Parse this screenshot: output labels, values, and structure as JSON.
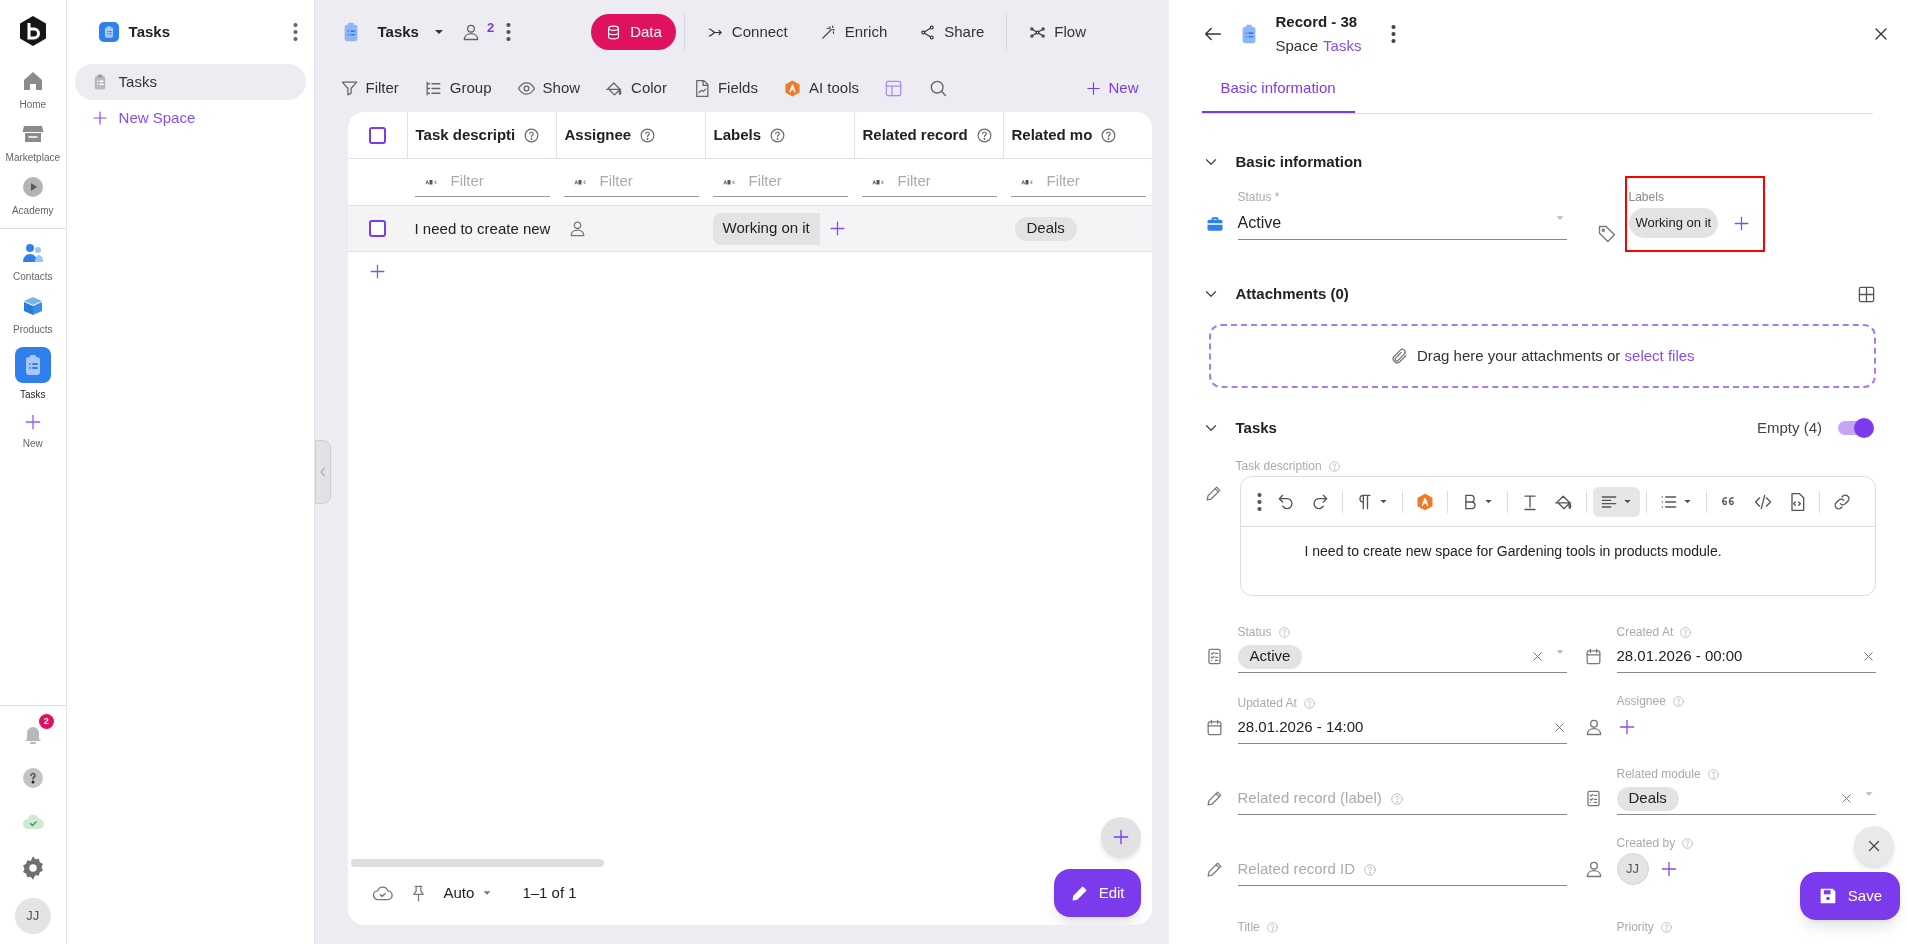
{
  "rail": {
    "items": [
      {
        "label": "Home",
        "kind": "home",
        "selected": false
      },
      {
        "label": "Marketplace",
        "kind": "store",
        "selected": false
      },
      {
        "label": "Academy",
        "kind": "play",
        "selected": false
      },
      {
        "label": "Contacts",
        "kind": "contacts",
        "selected": false
      },
      {
        "label": "Products",
        "kind": "box",
        "selected": false
      },
      {
        "label": "Tasks",
        "kind": "tasks",
        "selected": true
      },
      {
        "label": "New",
        "kind": "new",
        "selected": false
      }
    ],
    "notifications_badge": "2",
    "avatar": "JJ"
  },
  "spaces": {
    "title": "Tasks",
    "items": [
      {
        "label": "Tasks",
        "selected": true
      }
    ],
    "new_space": "New Space"
  },
  "main": {
    "title": "Tasks",
    "members_count": "2",
    "tabs": [
      {
        "label": "Data",
        "kind": "data",
        "selected": true
      },
      {
        "label": "Connect",
        "kind": "connect",
        "selected": false
      },
      {
        "label": "Enrich",
        "kind": "enrich",
        "selected": false
      },
      {
        "label": "Share",
        "kind": "share",
        "selected": false
      },
      {
        "label": "Flow",
        "kind": "flow",
        "selected": false
      }
    ],
    "toolbar": [
      {
        "label": "Filter",
        "kind": "filter"
      },
      {
        "label": "Group",
        "kind": "group"
      },
      {
        "label": "Show",
        "kind": "show"
      },
      {
        "label": "Color",
        "kind": "color"
      },
      {
        "label": "Fields",
        "kind": "fields"
      },
      {
        "label": "AI tools",
        "kind": "ai"
      }
    ],
    "new_button": "New"
  },
  "table": {
    "select_all_checked": false,
    "columns": [
      {
        "label": "Task descripti",
        "filter_placeholder": "Filter"
      },
      {
        "label": "Assignee",
        "filter_placeholder": "Filter"
      },
      {
        "label": "Labels",
        "filter_placeholder": "Filter"
      },
      {
        "label": "Related record",
        "filter_placeholder": "Filter"
      },
      {
        "label": "Related mo",
        "filter_placeholder": "Filter"
      }
    ],
    "rows": [
      {
        "checked": false,
        "task_description": "I need to create new",
        "labels": [
          "Working on it"
        ],
        "related_module": "Deals"
      }
    ]
  },
  "footer": {
    "view": "Auto",
    "range": "1–1 of 1",
    "edit_button": "Edit"
  },
  "record": {
    "title": "Record - 38",
    "space_prefix": "Space",
    "space_link": "Tasks",
    "tabs": [
      {
        "label": "Basic information",
        "selected": true
      }
    ],
    "basic": {
      "title": "Basic information",
      "expanded": true,
      "status": {
        "label": "Status *",
        "value": "Active"
      },
      "labels": {
        "label": "Labels",
        "chips": [
          "Working on it"
        ],
        "highlighted": true
      }
    },
    "attachments": {
      "title": "Attachments (0)",
      "expanded": true,
      "drop_text": "Drag here your attachments or",
      "drop_link": "select files"
    },
    "tasks": {
      "title": "Tasks",
      "expanded": true,
      "empty_label": "Empty (4)",
      "empty_toggle_on": true,
      "description_label": "Task description",
      "description_text": "I need to create new space for Gardening tools in products module.",
      "fields": [
        {
          "kind": "select",
          "label": "Status",
          "value": "Active"
        },
        {
          "kind": "date",
          "label": "Updated At",
          "value": "28.01.2026 - 14:00"
        },
        {
          "kind": "text",
          "label": "Related record (label)"
        },
        {
          "kind": "text",
          "label": "Related record ID"
        },
        {
          "kind": "label",
          "label": "Title"
        },
        {
          "kind": "date",
          "label": "Created At",
          "value": "28.01.2026 - 00:00"
        },
        {
          "kind": "user",
          "label": "Assignee"
        },
        {
          "kind": "select",
          "label": "Related module",
          "value": "Deals"
        },
        {
          "kind": "user",
          "label": "Created by",
          "avatars": [
            "JJ"
          ]
        },
        {
          "kind": "label",
          "label": "Priority"
        }
      ]
    },
    "save_button": "Save"
  }
}
